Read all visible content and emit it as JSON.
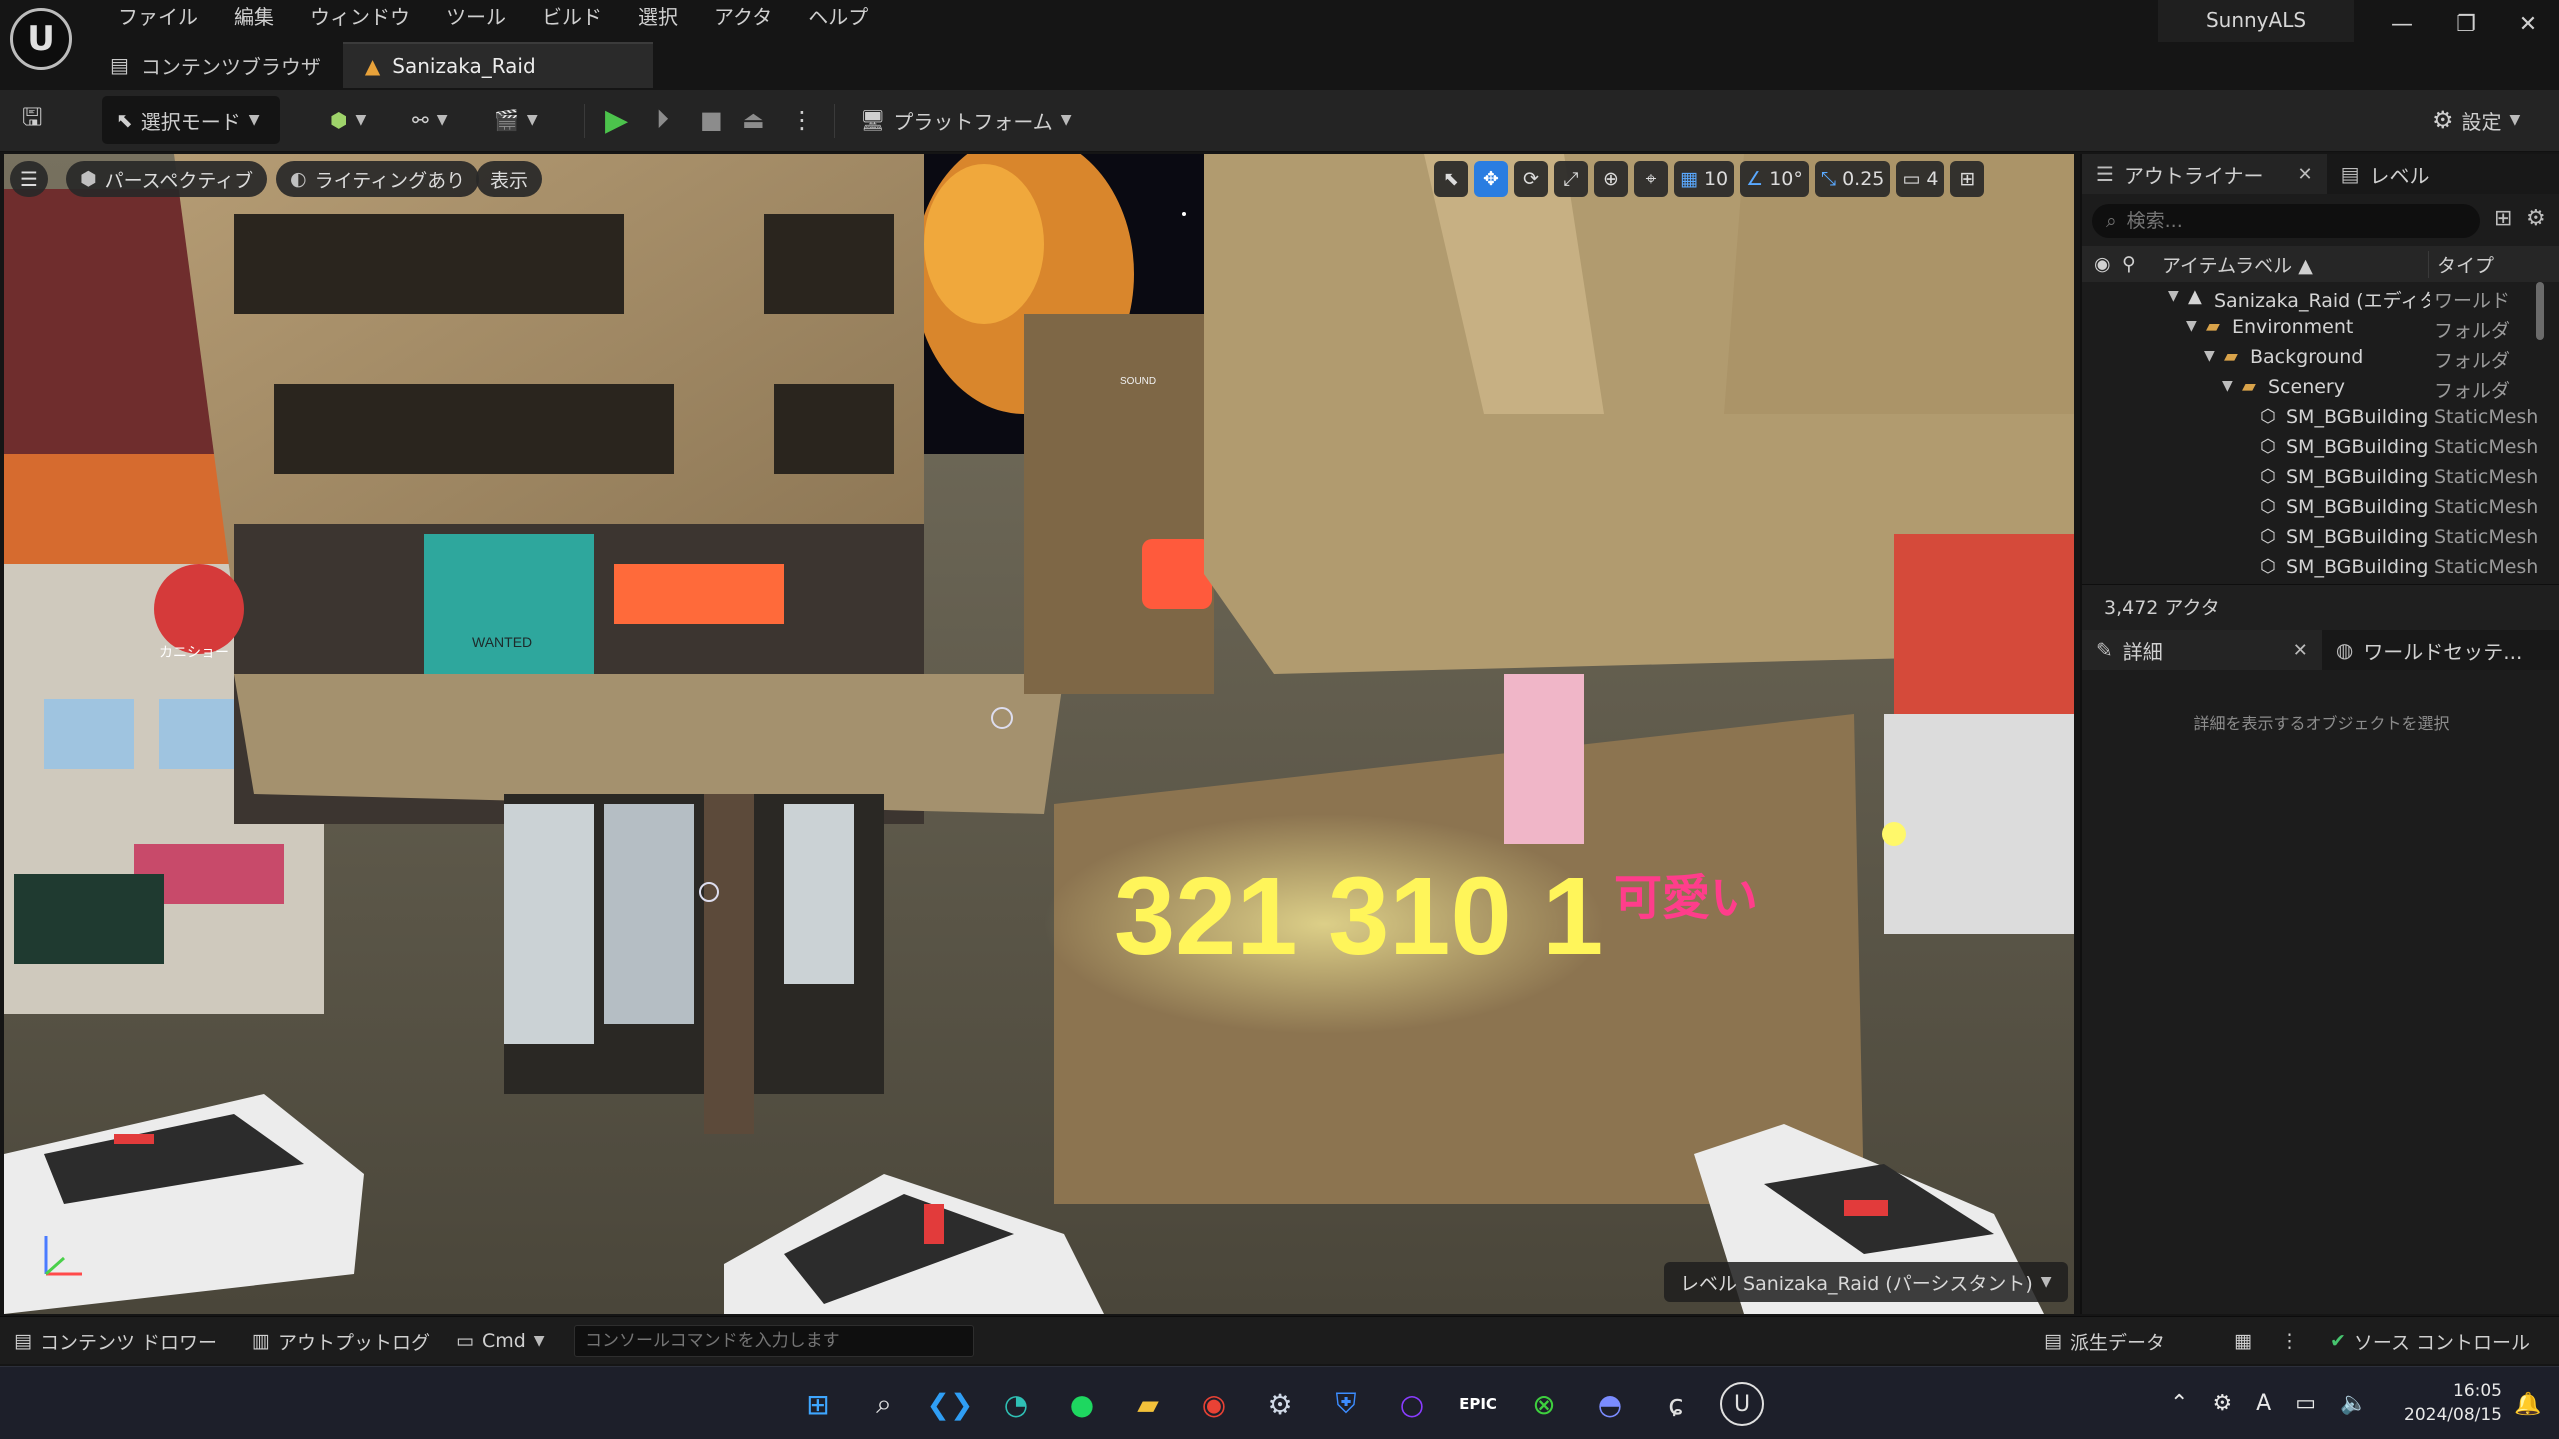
{
  "app": {
    "menu": [
      "ファイル",
      "編集",
      "ウィンドウ",
      "ツール",
      "ビルド",
      "選択",
      "アクタ",
      "ヘルプ"
    ],
    "project_name": "SunnyALS",
    "tabs": [
      {
        "label": "コンテンツブラウザ",
        "icon": "folder-icon"
      },
      {
        "label": "Sanizaka_Raid",
        "icon": "level-icon"
      }
    ],
    "window_buttons": [
      "—",
      "❐",
      "✕"
    ]
  },
  "toolbar": {
    "mode_label": "選択モード",
    "platform_label": "プラットフォーム",
    "settings_label": "設定"
  },
  "viewport": {
    "menu_icon": "hamburger-icon",
    "perspective_label": "パースペクティブ",
    "lighting_label": "ライティングあり",
    "show_label": "表示",
    "grid_snap": "10",
    "rotation_snap": "10°",
    "scale_snap": "0.25",
    "camera_speed": "4",
    "level_badge": "レベル  Sanizaka_Raid (パーシスタント)",
    "scene_text": {
      "sign_numbers": "321  310 1",
      "sign_kawaii": "可愛い",
      "poster_wanted": "WANTED",
      "poster_sound": "SOUND",
      "sign_kanisho": "カニショー"
    }
  },
  "outliner": {
    "tab_label": "アウトライナー",
    "level_tab_label": "レベル",
    "search_placeholder": "検索...",
    "col_label": "アイテムラベル ▲",
    "col_type": "タイプ",
    "rows": [
      {
        "name": "Sanizaka_Raid (エディタ)",
        "type": "ワールド",
        "depth": 0,
        "kind": "level"
      },
      {
        "name": "Environment",
        "type": "フォルダ",
        "depth": 1,
        "kind": "folder"
      },
      {
        "name": "Background",
        "type": "フォルダ",
        "depth": 2,
        "kind": "folder"
      },
      {
        "name": "Scenery",
        "type": "フォルダ",
        "depth": 3,
        "kind": "folder"
      },
      {
        "name": "SM_BGBuilding",
        "type": "StaticMesh",
        "depth": 4,
        "kind": "mesh"
      },
      {
        "name": "SM_BGBuilding",
        "type": "StaticMesh",
        "depth": 4,
        "kind": "mesh"
      },
      {
        "name": "SM_BGBuilding",
        "type": "StaticMesh",
        "depth": 4,
        "kind": "mesh"
      },
      {
        "name": "SM_BGBuilding",
        "type": "StaticMesh",
        "depth": 4,
        "kind": "mesh"
      },
      {
        "name": "SM_BGBuilding",
        "type": "StaticMesh",
        "depth": 4,
        "kind": "mesh"
      },
      {
        "name": "SM_BGBuilding",
        "type": "StaticMesh",
        "depth": 4,
        "kind": "mesh"
      }
    ],
    "actor_count": "3,472 アクタ"
  },
  "details": {
    "tab_label": "詳細",
    "world_tab_label": "ワールドセッテ...",
    "empty_message": "詳細を表示するオブジェクトを選択"
  },
  "statusbar": {
    "content_drawer": "コンテンツ ドロワー",
    "output_log": "アウトプットログ",
    "cmd_label": "Cmd",
    "cmd_placeholder": "コンソールコマンドを入力します",
    "derived_data": "派生データ",
    "source_control": "ソース コントロール"
  },
  "taskbar": {
    "apps": [
      "windows-start",
      "search",
      "vscode",
      "edge",
      "spotify",
      "file-explorer",
      "chrome",
      "steam",
      "vpn-shield",
      "circle-app",
      "epic-games",
      "xbox",
      "discord",
      "github-copilot",
      "unreal-engine"
    ],
    "epic_label": "EPIC",
    "ime_label": "A",
    "time": "16:05",
    "date": "2024/08/15"
  },
  "colors": {
    "accent_blue": "#2a7de1",
    "play_green": "#4cc34c",
    "neon_yellow": "#fff55a",
    "neon_pink": "#ff3d8b",
    "folder": "#d9a34a"
  }
}
